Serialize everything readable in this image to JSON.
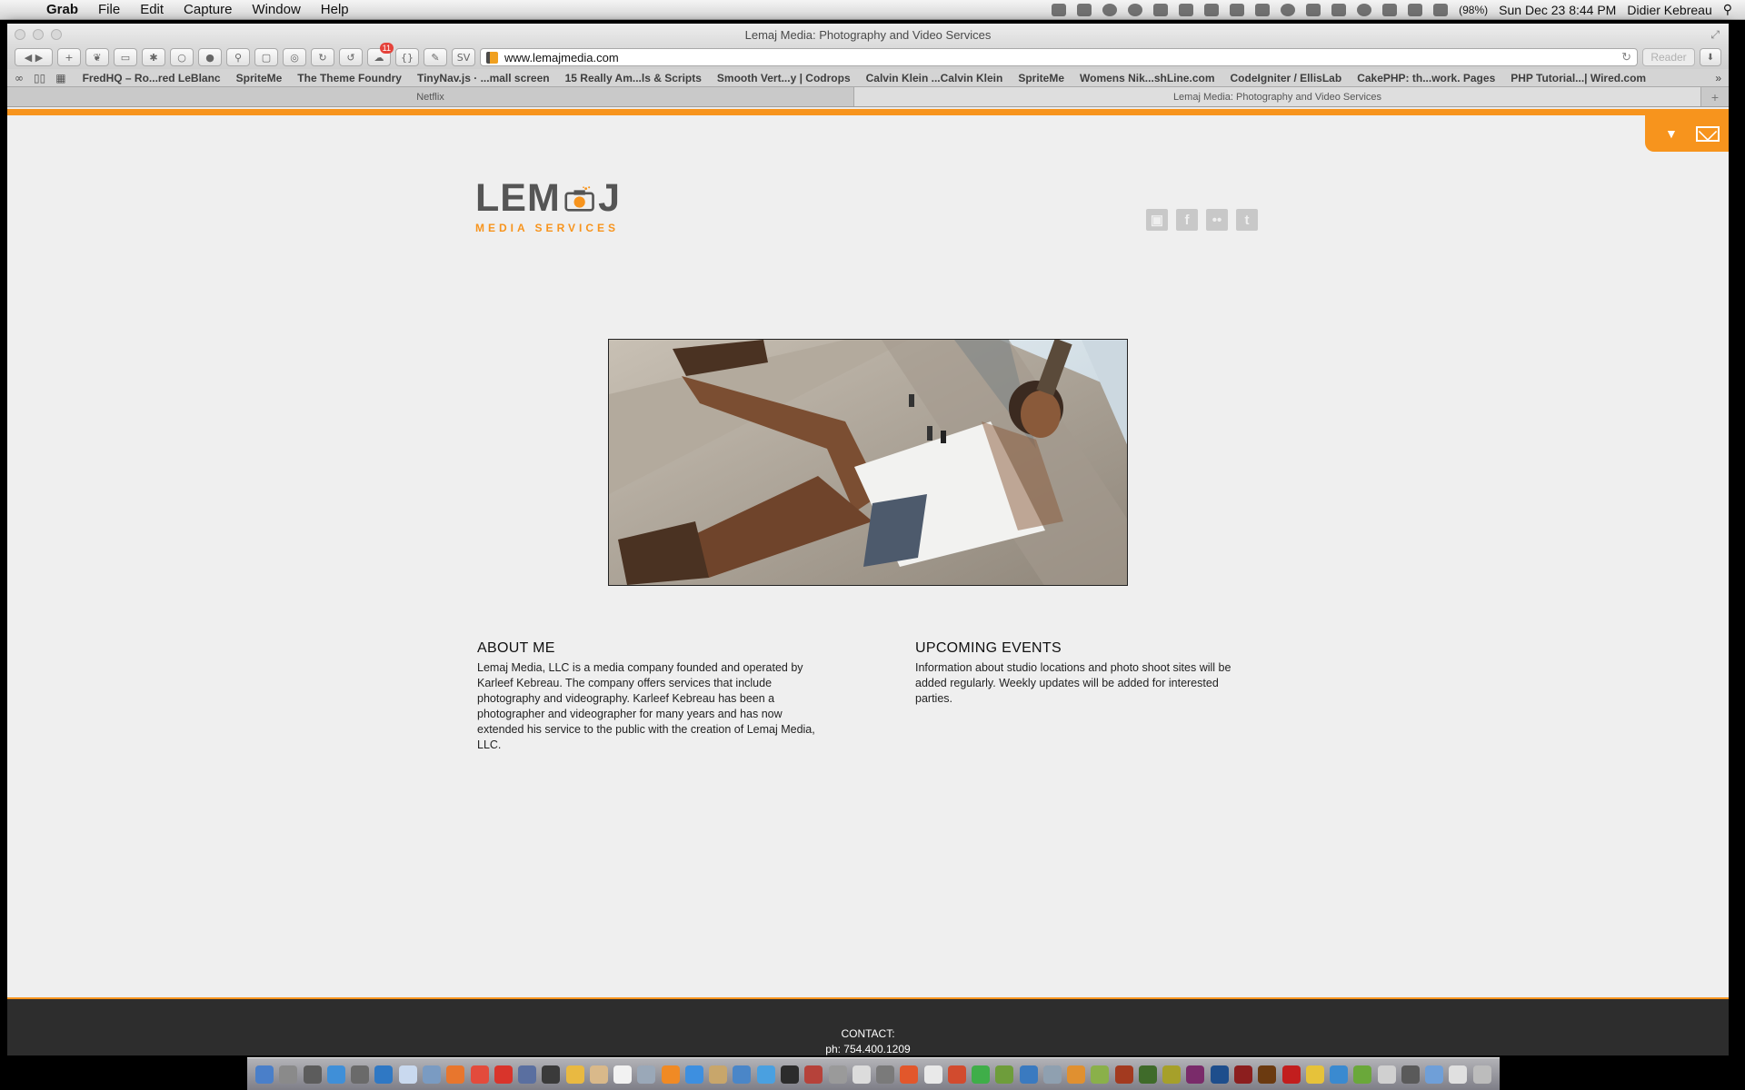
{
  "menubar": {
    "app": "Grab",
    "menus": [
      "File",
      "Edit",
      "Capture",
      "Window",
      "Help"
    ],
    "battery": "(98%)",
    "clock": "Sun Dec 23  8:44 PM",
    "user": "Didier Kebreau"
  },
  "browser": {
    "title": "Lemaj Media: Photography and Video Services",
    "url": "www.lemajmedia.com",
    "reader_label": "Reader",
    "badge_count": "11",
    "sv_label": "SV",
    "braces_label": "{}",
    "bookmarks": [
      "FredHQ – Ro...red LeBlanc",
      "SpriteMe",
      "The Theme Foundry",
      "TinyNav.js · ...mall screen",
      "15 Really Am...ls & Scripts",
      "Smooth Vert...y | Codrops",
      "Calvin Klein ...Calvin Klein",
      "SpriteMe",
      "Womens Nik...shLine.com",
      "CodeIgniter / EllisLab",
      "CakePHP: th...work. Pages",
      "PHP Tutorial...| Wired.com"
    ],
    "tabs": [
      {
        "label": "Netflix",
        "active": false
      },
      {
        "label": "Lemaj Media: Photography and Video Services",
        "active": true
      }
    ]
  },
  "page": {
    "logo": {
      "word_left": "LEM",
      "word_right": "J",
      "tagline": "MEDIA SERVICES"
    },
    "social_icons": [
      "image-icon",
      "facebook-icon",
      "flickr-icon",
      "twitter-icon"
    ],
    "about": {
      "heading": "ABOUT ME",
      "text": "Lemaj Media, LLC is a media company founded and operated by Karleef Kebreau.  The company offers services that include photography and videography.  Karleef Kebreau has been a photographer and videographer for many years and has now extended his service to the public with the creation of Lemaj Media, LLC."
    },
    "events": {
      "heading": "UPCOMING EVENTS",
      "text": "Information about studio locations and photo shoot sites will be added regularly. Weekly updates will be added for interested parties."
    },
    "footer": {
      "label": "CONTACT:",
      "phone": "ph: 754.400.1209"
    }
  },
  "colors": {
    "accent": "#f7941d",
    "footer": "#2d2d2d",
    "page_bg": "#efefef"
  }
}
